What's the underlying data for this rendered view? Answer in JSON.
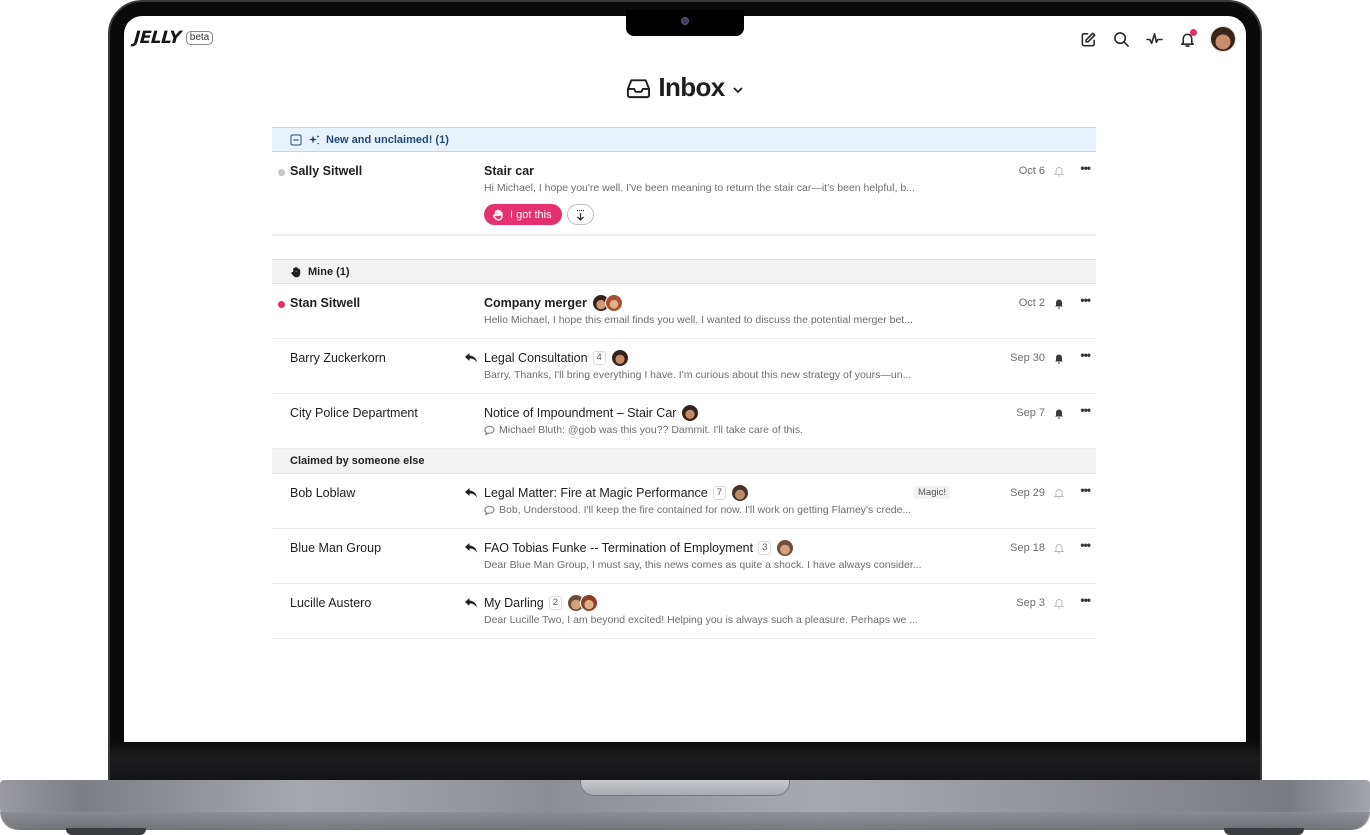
{
  "app": {
    "logo": "JELLY",
    "beta_label": "beta"
  },
  "topbar": {
    "icons": [
      "compose-icon",
      "search-icon",
      "activity-icon",
      "bell-icon",
      "avatar"
    ],
    "notification_dot_color": "#e52c6c"
  },
  "header": {
    "title": "Inbox",
    "icon": "inbox-tray-icon",
    "dropdown": "chevron-down-icon"
  },
  "sections": {
    "new": {
      "label": "New and unclaimed! (1)",
      "rows": [
        {
          "sender": "Sally Sitwell",
          "subject": "Stair car",
          "preview": "Hi Michael, I hope you're well. I've been meaning to return the stair car—it's been helpful, b...",
          "date": "Oct 6",
          "claim_label": "I got this",
          "bell": "outline"
        }
      ]
    },
    "mine": {
      "label": "Mine (1)",
      "rows": [
        {
          "sender": "Stan Sitwell",
          "subject": "Company merger",
          "preview": "Hello Michael, I hope this email finds you well. I wanted to discuss the potential merger bet...",
          "date": "Oct 2",
          "bell": "filled"
        },
        {
          "sender": "Barry Zuckerkorn",
          "subject": "Legal Consultation",
          "count": "4",
          "preview": "Barry, Thanks, I'll bring everything I have. I'm curious about this new strategy of yours—un...",
          "date": "Sep 30",
          "bell": "filled"
        },
        {
          "sender": "City Police Department",
          "subject": "Notice of Impoundment – Stair Car",
          "preview": "Michael Bluth: @gob was this you?? Dammit. I'll take care of this.",
          "date": "Sep 7",
          "bell": "filled"
        }
      ]
    },
    "claimed": {
      "label": "Claimed by someone else",
      "rows": [
        {
          "sender": "Bob Loblaw",
          "subject": "Legal Matter: Fire at Magic Performance",
          "count": "7",
          "tag": "Magic!",
          "preview": "Bob, Understood. I'll keep the fire contained for now. I'll work on getting Flamey's crede...",
          "date": "Sep 29",
          "bell": "outline"
        },
        {
          "sender": "Blue Man Group",
          "subject": "FAO Tobias Funke -- Termination of Employment",
          "count": "3",
          "preview": "Dear Blue Man Group, I must say, this news comes as quite a shock. I have always consider...",
          "date": "Sep 18",
          "bell": "outline"
        },
        {
          "sender": "Lucille Austero",
          "subject": "My Darling",
          "count": "2",
          "preview": "Dear Lucille Two, I am beyond excited! Helping you is always such a pleasure. Perhaps we ...",
          "date": "Sep 3",
          "bell": "outline"
        }
      ]
    }
  },
  "colors": {
    "accent": "#e5306f",
    "new_section_bg": "#e7f2fc",
    "unread_dot": "#e52c6c",
    "unclaimed_dot": "#c7c7cc"
  },
  "more_label": "•••"
}
